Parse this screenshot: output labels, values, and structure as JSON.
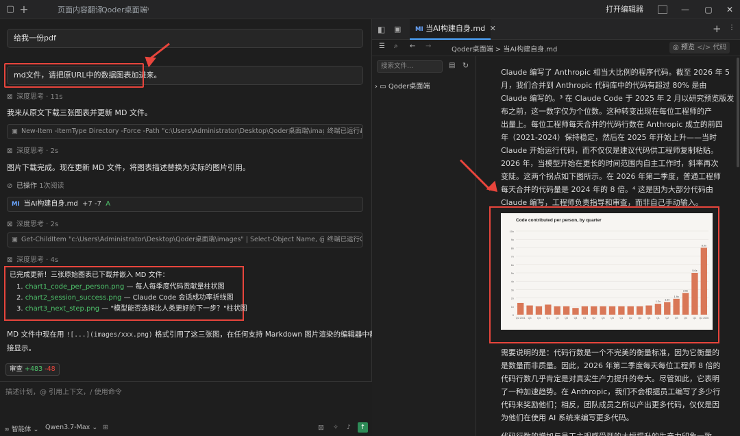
{
  "titlebar": {
    "tab1": "页面内容翻译",
    "tab2": "Qoder桌面端",
    "open_editor": "打开编辑器"
  },
  "chat": {
    "msg1": "给我一份pdf",
    "msg2": "md文件，请把原URL中的数据图表加进来。",
    "think1": "深度思考 · 11s",
    "text1": "我来从原文下载三张图表并更新 MD 文件。",
    "cmd1": "New-Item -ItemType Directory -Force -Path \"c:\\Users\\Administrator\\Desktop\\Qoder桌面端\\images\" | Out-Null; ...",
    "cmd1_status": "终端已运行",
    "think2": "深度思考 · 2s",
    "text2": "图片下载完成。现在更新 MD 文件，将图表描述替换为实际的图片引用。",
    "ops_label": "已操作",
    "ops_count": "1次阅读",
    "file_badge": "MI",
    "file_name": "当AI构建自身.md",
    "file_diff": "+7 -7",
    "file_flag": "A",
    "think3": "深度思考 · 2s",
    "cmd2": "Get-ChildItem \"c:\\Users\\Administrator\\Desktop\\Qoder桌面端\\images\" | Select-Object Name, @{N='Size(KB)';E...",
    "cmd2_status": "终端已运行",
    "think4": "深度思考 · 4s",
    "summary_title": "已完成更新！三张原始图表已下载并嵌入 MD 文件：",
    "items": [
      {
        "num": "1.",
        "link": "chart1_code_per_person.png",
        "desc": " — 每人每季度代码贡献量柱状图"
      },
      {
        "num": "2.",
        "link": "chart2_session_success.png",
        "desc": " — Claude Code 会话成功率折线图"
      },
      {
        "num": "3.",
        "link": "chart3_next_step.png",
        "desc": " — \"模型能否选择比人类更好的下一步？\"柱状图"
      }
    ],
    "final_pre": "MD 文件中现在用 ",
    "final_code": "![...](images/xxx.png)",
    "final_post": " 格式引用了这三张图，在任何支持 Markdown 图片渲染的编辑器中都能直",
    "final_line2": "接显示。",
    "review_label": "审查",
    "review_add": "+483",
    "review_del": "-48",
    "input_placeholder": "描述计划，@ 引用上下文，/ 使用命令",
    "agent_label": "智能体",
    "model_label": "Qwen3.7-Max"
  },
  "explorer": {
    "search_placeholder": "搜索文件...",
    "folder": "Qoder桌面端"
  },
  "editor": {
    "tab_badge": "MI",
    "tab_title": "当AI构建自身.md",
    "breadcrumb": "Qoder桌面端 > 当AI构建自身.md",
    "preview_label": "预览",
    "code_label": "代码",
    "para1": [
      "Claude 编写了 Anthropic 相当大比例的程序代码。截至 2026 年 5",
      "月，我们合并到 Anthropic 代码库中的代码有超过 80% 是由",
      "Claude 编写的。³ 在 Claude Code 于 2025 年 2 月以研究预览版发",
      "布之前，这一数字仅为个位数。这种转变出现在每位工程师的产",
      "出量上。每位工程师每天合并的代码行数在 Anthropic 成立的前四",
      "年（2021-2024）保持稳定，然后在 2025 年开始上升——当时",
      "Claude 开始运行代码，而不仅仅是建议代码供工程师复制粘贴。",
      "2026 年，当模型开始在更长的时间范围内自主工作时，斜率再次",
      "变陡。这两个拐点如下图所示。在 2026 年第二季度，普通工程师",
      "每天合并的代码量是 2024 年的 8 倍。⁴ 这是因为大部分代码由",
      "Claude 编写，工程师负责指导和审查，而非自己手动输入。"
    ],
    "para2": [
      "需要说明的是：代码行数是一个不完美的衡量标准，因为它衡量的",
      "是数量而非质量。因此，2026 年第二季度每天每位工程师 8 倍的",
      "代码行数几乎肯定是对真实生产力提升的夸大。尽管如此，它表明",
      "了一种加速趋势。在 Anthropic，我们不会根据员工编写了多少行",
      "代码来奖励他们；相反，团队成员之所以产出更多代码，仅仅是因",
      "为他们在使用 AI 系统来编写更多代码。"
    ],
    "para3": "代码行数的增加与员工主观感受到的大幅提升的生产力印象一致"
  },
  "chart_data": {
    "type": "bar",
    "title": "Code contributed per person, by quarter",
    "categories": [
      "Q2 2021",
      "Q3",
      "Q4",
      "Q1",
      "Q2",
      "Q3",
      "Q4",
      "Q1",
      "Q2",
      "Q3",
      "Q4",
      "Q1",
      "Q2",
      "Q3",
      "Q4",
      "Q1",
      "Q2",
      "Q3",
      "Q4",
      "Q1",
      "Q2 2026"
    ],
    "values": [
      1.4,
      1.1,
      1.0,
      1.2,
      1.0,
      1.0,
      0.8,
      1.0,
      1.0,
      1.0,
      1.0,
      1.0,
      1.0,
      1.0,
      1.1,
      1.3,
      1.5,
      1.9,
      2.6,
      5.0,
      8.0
    ],
    "data_labels": [
      "",
      "",
      "",
      "",
      "",
      "",
      "",
      "",
      "",
      "",
      "",
      "",
      "",
      "",
      "",
      "1.2x",
      "1.5x",
      "1.9x",
      "2.6x",
      "5.0x",
      "8.0x"
    ],
    "yticks": [
      "0",
      "1x",
      "2x",
      "3x",
      "4x",
      "5x",
      "6x",
      "7x",
      "8x",
      "9x",
      "10x"
    ],
    "ylim": [
      0,
      10
    ],
    "bar_color": "#d97757"
  }
}
